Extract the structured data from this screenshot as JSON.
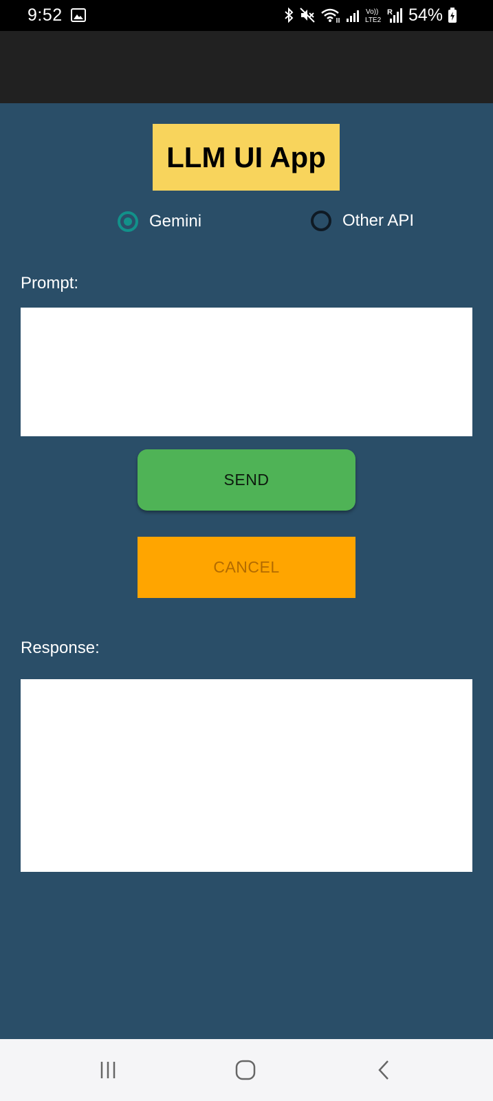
{
  "status_bar": {
    "time": "9:52",
    "battery": "54%",
    "icons": [
      "gallery-icon",
      "bluetooth-icon",
      "mute-icon",
      "wifi-icon",
      "signal-icon",
      "volte-lte2-icon",
      "roaming-signal-icon",
      "battery-charging-icon"
    ]
  },
  "app": {
    "title": "LLM UI App",
    "title_bg": "#f8d45c"
  },
  "api_selector": {
    "options": [
      {
        "label": "Gemini",
        "checked": true
      },
      {
        "label": "Other API",
        "checked": false
      }
    ],
    "accent": "#12918a"
  },
  "prompt": {
    "label": "Prompt:",
    "value": ""
  },
  "buttons": {
    "send_label": "SEND",
    "send_color": "#4fb356",
    "cancel_label": "CANCEL",
    "cancel_color": "#ffa500"
  },
  "response": {
    "label": "Response:",
    "value": ""
  },
  "theme": {
    "background": "#2a4e68",
    "app_bar": "#212121"
  },
  "nav_bar": {
    "icons": [
      "recents-icon",
      "home-icon",
      "back-icon"
    ]
  }
}
